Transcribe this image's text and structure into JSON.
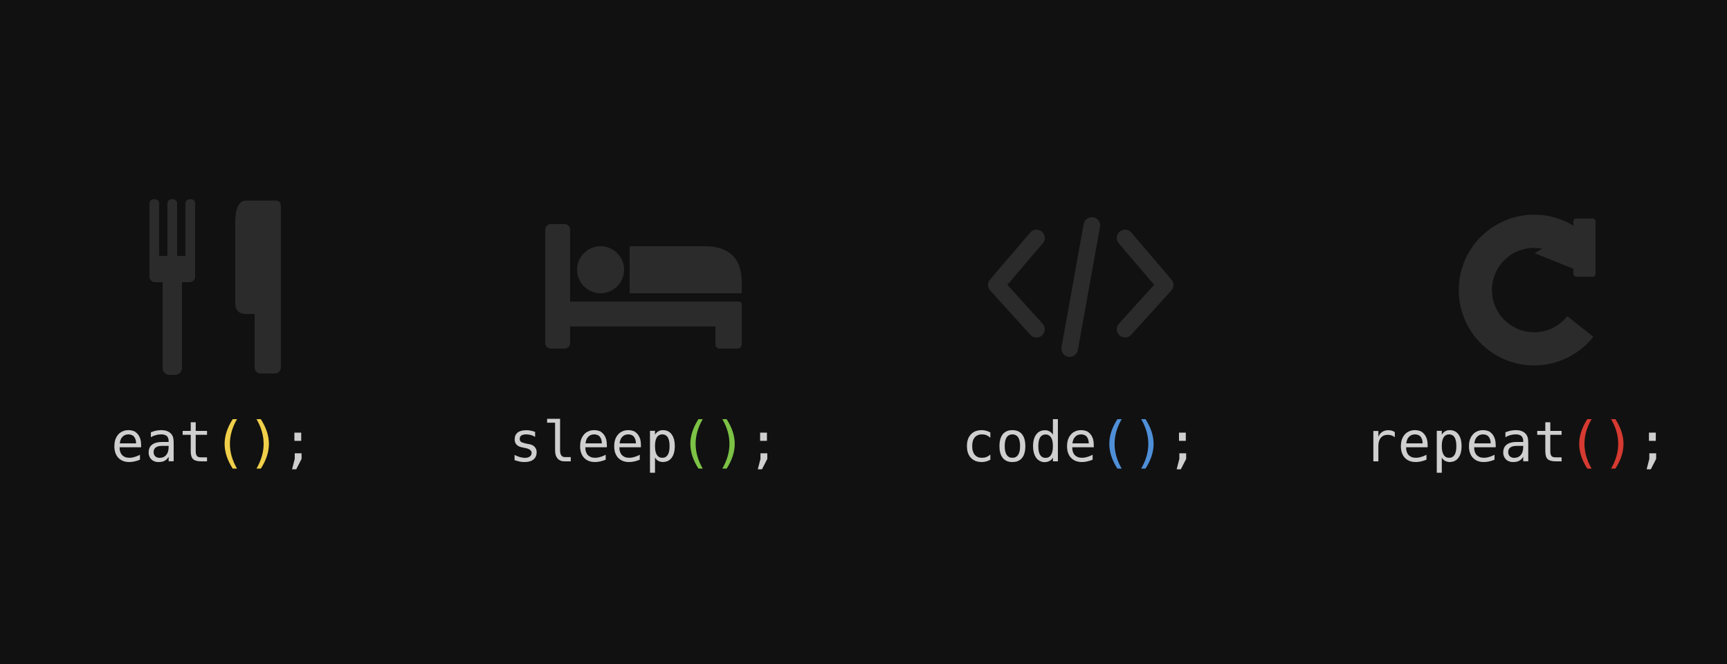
{
  "colors": {
    "background": "#111111",
    "icon": "#2b2b2b",
    "text": "#cfcfcf"
  },
  "items": [
    {
      "icon": "fork-knife-icon",
      "name": "eat",
      "open": "(",
      "close": ")",
      "semicolon": ";",
      "paren_color": "#f0cf4a"
    },
    {
      "icon": "bed-icon",
      "name": "sleep",
      "open": "(",
      "close": ")",
      "semicolon": ";",
      "paren_color": "#7cc245"
    },
    {
      "icon": "code-icon",
      "name": "code",
      "open": "(",
      "close": ")",
      "semicolon": ";",
      "paren_color": "#4f8fd8"
    },
    {
      "icon": "refresh-icon",
      "name": "repeat",
      "open": "(",
      "close": ")",
      "semicolon": ";",
      "paren_color": "#d63a31"
    }
  ]
}
